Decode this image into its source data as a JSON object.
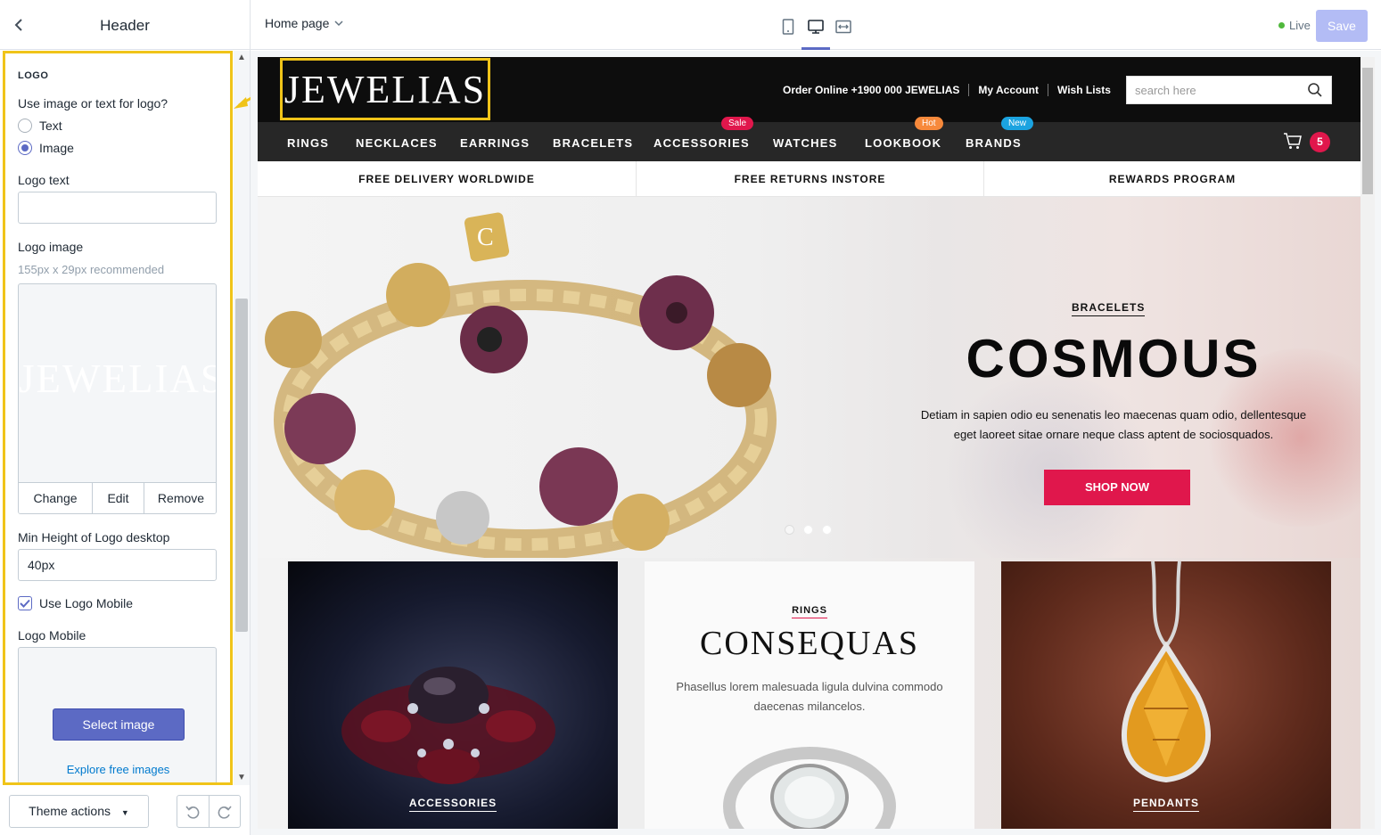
{
  "sidebar": {
    "title": "Header",
    "section_title": "LOGO",
    "logo_type_label": "Use image or text for logo?",
    "logo_type_options": [
      "Text",
      "Image"
    ],
    "logo_type_selected": "Image",
    "logo_text_label": "Logo text",
    "logo_text_value": "",
    "logo_image_label": "Logo image",
    "logo_image_hint": "155px x 29px recommended",
    "logo_image_preview_text": "JEWELIAS",
    "image_actions": [
      "Change",
      "Edit",
      "Remove"
    ],
    "min_height_label": "Min Height of Logo desktop",
    "min_height_value": "40px",
    "use_logo_mobile_label": "Use Logo Mobile",
    "use_logo_mobile_checked": true,
    "logo_mobile_label": "Logo Mobile",
    "select_image_label": "Select image",
    "explore_link": "Explore free images",
    "theme_actions_label": "Theme actions"
  },
  "topbar": {
    "page_selector": "Home page",
    "live_label": "Live",
    "save_label": "Save",
    "active_device": "desktop"
  },
  "site": {
    "logo_text": "JEWELIAS",
    "header_links": [
      "Order Online +1900 000 JEWELIAS",
      "My Account",
      "Wish Lists"
    ],
    "search_placeholder": "search here",
    "nav": [
      {
        "label": "RINGS",
        "badge": ""
      },
      {
        "label": "NECKLACES",
        "badge": ""
      },
      {
        "label": "EARRINGS",
        "badge": ""
      },
      {
        "label": "BRACELETS",
        "badge": ""
      },
      {
        "label": "ACCESSORIES",
        "badge": "Sale",
        "badge_color": "#e0174c"
      },
      {
        "label": "WATCHES",
        "badge": ""
      },
      {
        "label": "LOOKBOOK",
        "badge": "Hot",
        "badge_color": "#f7893b"
      },
      {
        "label": "BRANDS",
        "badge": "New",
        "badge_color": "#1ba3e0"
      }
    ],
    "cart_count": "5",
    "promos": [
      "FREE DELIVERY WORLDWIDE",
      "FREE RETURNS INSTORE",
      "REWARDS PROGRAM"
    ],
    "hero": {
      "kicker": "BRACELETS",
      "title": "COSMOUS",
      "text": "Detiam in sapien odio eu senenatis leo maecenas quam odio, dellentesque eget laoreet sitae ornare neque class aptent de sociosquados.",
      "button": "SHOP NOW"
    },
    "tiles": {
      "left_label": "ACCESSORIES",
      "mid_kicker": "RINGS",
      "mid_title": "CONSEQUAS",
      "mid_text": "Phasellus lorem malesuada ligula dulvina commodo daecenas milancelos.",
      "right_label": "PENDANTS"
    }
  },
  "colors": {
    "accent": "#5c6ac4",
    "highlight": "#f0c419",
    "brand_red": "#e0174c"
  }
}
